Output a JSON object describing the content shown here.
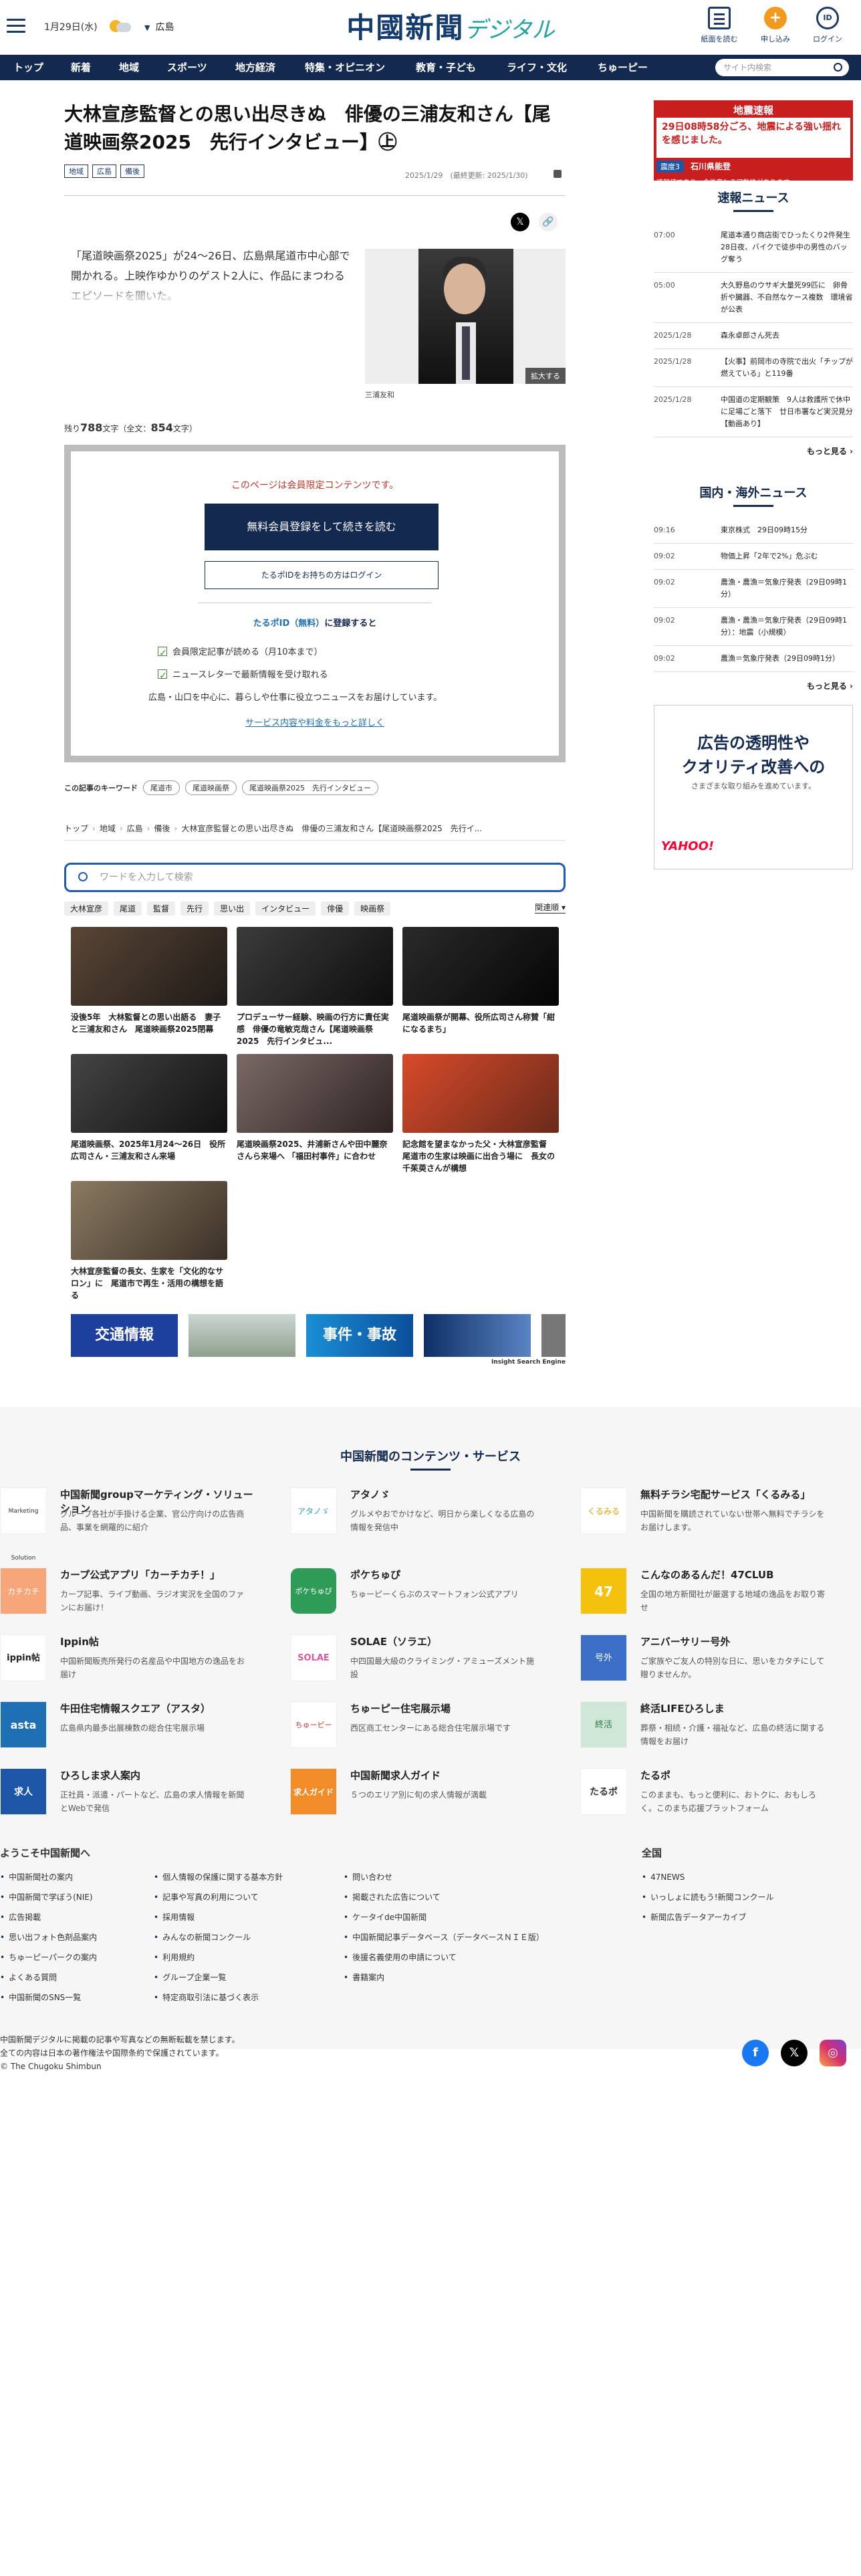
{
  "header": {
    "date": "1月29日(水)",
    "area": "広島",
    "logo_main": "中國新聞",
    "logo_sub": "デジタル",
    "btn_paper": "紙面を読む",
    "btn_signup": "申し込み",
    "btn_login": "ログイン",
    "signup_icon": "+",
    "login_icon": "ID"
  },
  "nav": {
    "items": [
      "トップ",
      "新着",
      "地域",
      "スポーツ",
      "地方経済",
      "特集・オピニオン",
      "教育・子ども",
      "ライフ・文化",
      "ちゅーピー"
    ],
    "search_placeholder": "サイト内検索"
  },
  "article": {
    "title": "大林宣彦監督との思い出尽きぬ　俳優の三浦友和さん【尾道映画祭2025　先行インタビュー】㊤",
    "tags": [
      "地域",
      "広島",
      "備後"
    ],
    "meta": "2025/1/29　(最終更新: 2025/1/30)",
    "lead": "「尾道映画祭2025」が24～26日、広島県尾道市中心部で開かれる。上映作ゆかりのゲスト2人に、作品にまつわるエピソードを聞いた。",
    "enlarge": "拡大する",
    "caption": "三浦友和",
    "count_prefix": "残り",
    "count_remaining": "788",
    "count_mid": "文字（全文：",
    "count_total": "854",
    "count_suffix": "文字）"
  },
  "paywall": {
    "notice": "このページは会員限定コンテンツです。",
    "primary": "無料会員登録をして続きを読む",
    "secondary": "たるポIDをお持ちの方はログイン",
    "id_prefix": "たるポID",
    "id_mid": "（無料）",
    "id_suffix": "に登録すると",
    "benefits": [
      "会員限定記事が読める（月10本まで）",
      "ニュースレターで最新情報を受け取れる"
    ],
    "benefit_note": "広島・山口を中心に、暮らしや仕事に役立つニュースをお届けしています。",
    "more": "サービス内容や料金をもっと詳しく"
  },
  "keywords": {
    "label": "この記事のキーワード",
    "items": [
      "尾道市",
      "尾道映画祭",
      "尾道映画祭2025　先行インタビュー"
    ]
  },
  "breadcrumb": [
    "トップ",
    "地域",
    "広島",
    "備後",
    "大林宣彦監督との思い出尽きぬ　俳優の三浦友和さん【尾道映画祭2025　先行イ..."
  ],
  "ise": {
    "placeholder": "ワードを入力して検索",
    "keywords": [
      "大林宣彦",
      "尾道",
      "監督",
      "先行",
      "思い出",
      "インタビュー",
      "俳優",
      "映画祭"
    ],
    "sort": "関連順",
    "cards": [
      "没後5年　大林監督との思い出語る　妻子と三浦友和さん　尾道映画祭2025閉幕",
      "プロデューサー経験、映画の行方に責任実感　俳優の竜敏克哉さん【尾道映画祭2025　先行インタビュ...",
      "尾道映画祭が開幕、役所広司さん称賛「紺になるまち」",
      "尾道映画祭、2025年1月24～26日　役所広司さん・三浦友和さん来場",
      "尾道映画祭2025、井浦新さんや田中麗奈さんら来場へ 「福田村事件」に合わせ",
      "記念館を望まなかった父・大林宣彦監督　尾道市の生家は映画に出合う場に　長女の千茱萸さんが構想",
      "大林宣彦監督の長女、生家を「文化的なサロン」に　尾道市で再生・活用の構想を語る"
    ],
    "banner1": "交通情報",
    "banner3": "事件・事故",
    "mark": "Insight Search Engine"
  },
  "side": {
    "quake_title": "地震速報",
    "quake_msg": "29日08時58分ごろ、地震による強い揺れを感じました。",
    "quake_level": "震度3",
    "quake_place": "石川県能登",
    "quake_foot": "速報値であり、今後変わる可能性があります",
    "flash_title": "速報ニュース",
    "flash": [
      {
        "t": "07:00",
        "x": "尾道本通り商店街でひったくり2件発生　28日夜、バイクで徒歩中の男性のバッグ奪う"
      },
      {
        "t": "05:00",
        "x": "大久野島のウサギ大量死99匹に　卵骨折や臓器、不自然なケース複数　環境省が公表"
      },
      {
        "t": "2025/1/28",
        "x": "森永卓郎さん死去"
      },
      {
        "t": "2025/1/28",
        "x": "【火事】前岡市の寺院で出火「チップが燃えている」と119番"
      },
      {
        "t": "2025/1/28",
        "x": "中国道の定期観策　9人は救護所で休中に足場ごと落下　廿日市署など実況見分【動画あり】"
      }
    ],
    "more": "もっと見る ›",
    "intl_title": "国内・海外ニュース",
    "intl": [
      {
        "t": "09:16",
        "x": "東京株式　29日09時15分"
      },
      {
        "t": "09:02",
        "x": "物価上昇「2年で2%」危ぶむ"
      },
      {
        "t": "09:02",
        "x": "農漁・農漁＝気象庁発表（29日09時1分）"
      },
      {
        "t": "09:02",
        "x": "農漁・農漁＝気象庁発表（29日09時1分）：地震（小規模）"
      },
      {
        "t": "09:02",
        "x": "農漁＝気象庁発表（29日09時1分）"
      }
    ],
    "ad_line1": "広告の透明性や",
    "ad_line2": "クオリティ改善への",
    "ad_line3": "さまざまな取り組みを進めています。",
    "ad_brand": "YAHOO!"
  },
  "footer": {
    "title": "中国新聞のコンテンツ・サービス",
    "services": [
      {
        "n": "中国新聞groupマーケティング・ソリューション",
        "d": "グループ各社が手掛ける企業、官公庁向けの広告商品、事業を網羅的に紹介",
        "logo": "Marketing Solution"
      },
      {
        "n": "アタノゞ",
        "d": "グルメやおでかけなど、明日から楽しくなる広島の情報を発信中",
        "logo": "アタノゞ"
      },
      {
        "n": "無料チラシ宅配サービス「くるみる」",
        "d": "中国新聞を購読されていない世帯へ無料でチラシをお届けします。",
        "logo": "くるみる"
      },
      {
        "n": "カープ公式アプリ「カーチカチ！」",
        "d": "カープ記事、ライブ動画、ラジオ実況を全国のファンにお届け！",
        "logo": "カチカチ"
      },
      {
        "n": "ポケちゅぴ",
        "d": "ちゅーピーくらぶのスマートフォン公式アプリ",
        "logo": "ポケちゅぴ"
      },
      {
        "n": "こんなのあるんだ！47CLUB",
        "d": "全国の地方新聞社が厳選する地域の逸品をお取り寄せ",
        "logo": "47"
      },
      {
        "n": "Ippin帖",
        "d": "中国新聞販売所発行の名産品や中国地方の逸品をお届け",
        "logo": "ippin帖"
      },
      {
        "n": "SOLAE（ソラエ）",
        "d": "中四国最大級のクライミング・アミューズメント施設",
        "logo": "SOLAE"
      },
      {
        "n": "アニバーサリー号外",
        "d": "ご家族やご友人の特別な日に、思いをカタチにして贈りませんか。",
        "logo": "号外"
      },
      {
        "n": "牛田住宅情報スクエア（アスタ）",
        "d": "広島県内最多出展棟数の総合住宅展示場",
        "logo": "asta"
      },
      {
        "n": "ちゅーピー住宅展示場",
        "d": "西区商工センターにある総合住宅展示場です",
        "logo": "ちゅーピー"
      },
      {
        "n": "終活LIFEひろしま",
        "d": "葬祭・相続・介護・福祉など、広島の終活に関する情報をお届け",
        "logo": "終活"
      },
      {
        "n": "ひろしま求人案内",
        "d": "正社員・派遣・パートなど、広島の求人情報を新聞とWebで発信",
        "logo": "求人"
      },
      {
        "n": "中国新聞求人ガイド",
        "d": "５つのエリア別に旬の求人情報が満載",
        "logo": "求人ガイド"
      },
      {
        "n": "たるポ",
        "d": "このままも、もっと便利に、おトクに、おもしろく。このまち応援プラットフォーム",
        "logo": "たるポ"
      }
    ],
    "welcome": "ようこそ中国新聞へ",
    "col1": [
      "中国新聞社の案内",
      "中国新聞で学ぼう(NIE)",
      "広告掲載",
      "思い出フォト色剤品案内",
      "ちゅーピーパークの案内",
      "よくある質問",
      "中国新聞のSNS一覧"
    ],
    "col2": [
      "個人情報の保護に関する基本方針",
      "記事や写真の利用について",
      "採用情報",
      "みんなの新聞コンクール",
      "利用規約",
      "グループ企業一覧",
      "特定商取引法に基づく表示"
    ],
    "col3": [
      "問い合わせ",
      "掲載された広告について",
      "ケータイde中国新聞",
      "中国新聞記事データベース（データベースＮＩＥ版）",
      "後援名義使用の申請について",
      "書籍案内"
    ],
    "national": "全国",
    "col4": [
      "47NEWS",
      "いっしょに読もう!新聞コンクール",
      "新聞広告データアーカイブ"
    ],
    "copy1": "中国新聞デジタルに掲載の記事や写真などの無断転載を禁じます。",
    "copy2": "全ての内容は日本の著作権法や国際条約で保護されています。",
    "copy3": "© The Chugoku Shimbun",
    "fb": "f",
    "x": "𝕏",
    "ig": "◎"
  }
}
